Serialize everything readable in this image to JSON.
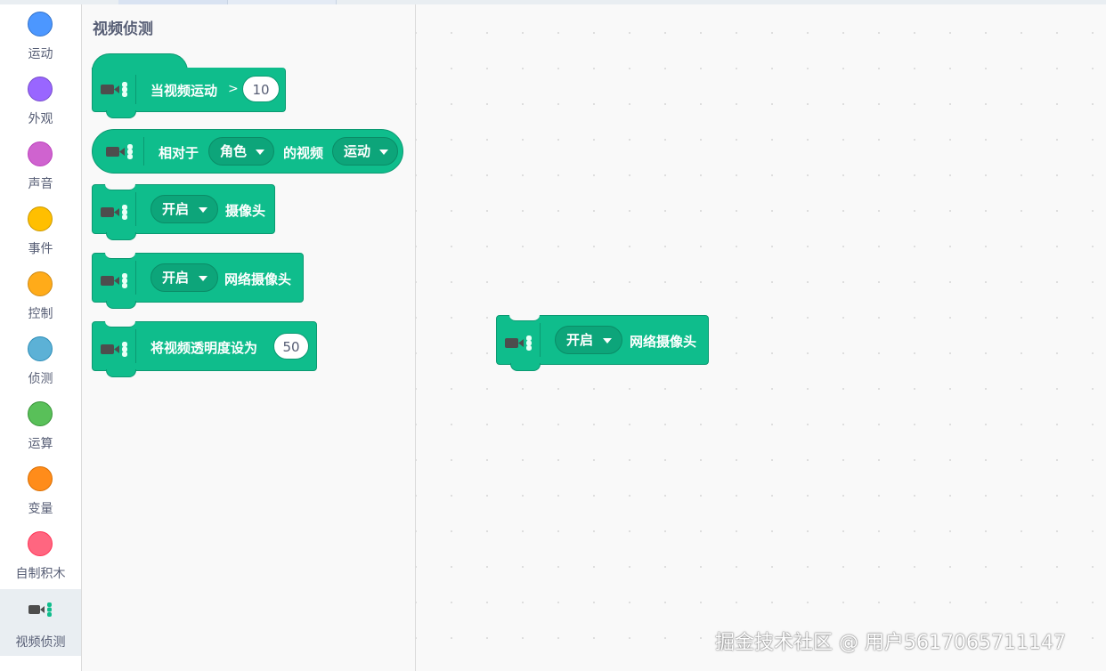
{
  "categories": [
    {
      "label": "运动",
      "color": "#4c97ff",
      "border": "#3373cc"
    },
    {
      "label": "外观",
      "color": "#9966ff",
      "border": "#774dcb"
    },
    {
      "label": "声音",
      "color": "#cf63cf",
      "border": "#bd42bd"
    },
    {
      "label": "事件",
      "color": "#ffbf00",
      "border": "#cc9900"
    },
    {
      "label": "控制",
      "color": "#ffab19",
      "border": "#cf8b17"
    },
    {
      "label": "侦测",
      "color": "#5cb1d6",
      "border": "#2e8eb8"
    },
    {
      "label": "运算",
      "color": "#59c059",
      "border": "#389438"
    },
    {
      "label": "变量",
      "color": "#ff8c1a",
      "border": "#db6e00"
    },
    {
      "label": "自制积木",
      "color": "#ff6680",
      "border": "#ff3355"
    },
    {
      "label": "视频侦测",
      "icon": "video-camera-icon",
      "selected": true
    }
  ],
  "flyout": {
    "title": "视频侦测",
    "blocks": {
      "when_motion": {
        "text": "当视频运动",
        "op": ">",
        "value": "10"
      },
      "video_on": {
        "prefix": "相对于",
        "target": "角色",
        "middle": "的视频",
        "attribute": "运动"
      },
      "turn_camera": {
        "option": "开启",
        "suffix": "摄像头"
      },
      "turn_webcam": {
        "option": "开启",
        "suffix": "网络摄像头"
      },
      "set_transparency": {
        "text": "将视频透明度设为",
        "value": "50"
      }
    }
  },
  "workspace": {
    "block": {
      "option": "开启",
      "suffix": "网络摄像头"
    }
  },
  "colors": {
    "extension_block": "#0fbd8c",
    "extension_border": "#0b9a72",
    "sidebar_text": "#575e75"
  },
  "watermark": "掘金技术社区 @ 用户5617065711147"
}
